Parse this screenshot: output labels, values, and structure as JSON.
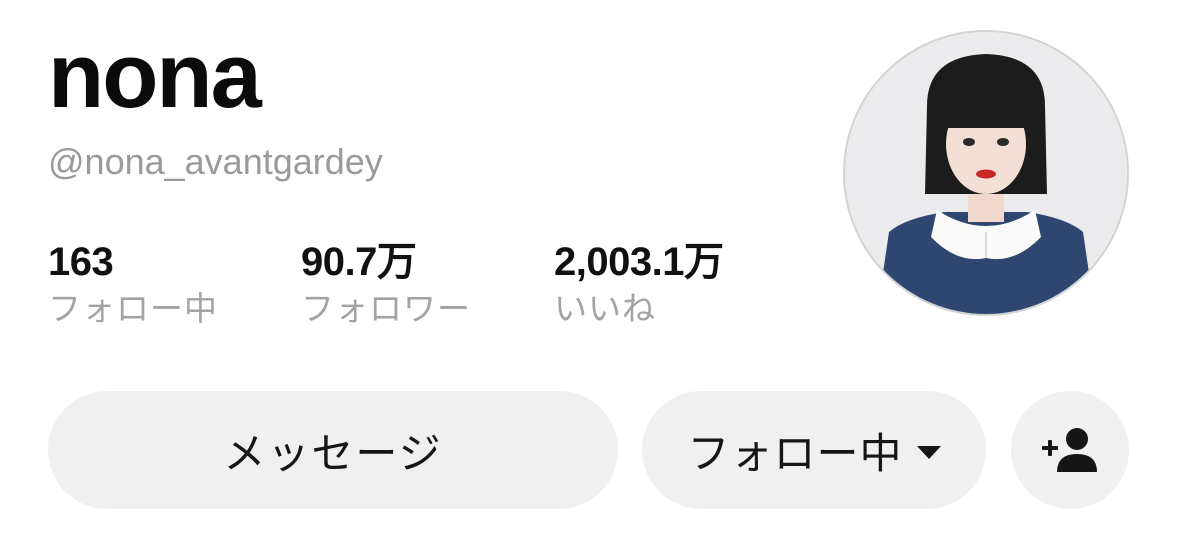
{
  "profile": {
    "name": "nona",
    "handle": "@nona_avantgardey"
  },
  "stats": [
    {
      "value": "163",
      "label": "フォロー中"
    },
    {
      "value": "90.7万",
      "label": "フォロワー"
    },
    {
      "value": "2,003.1万",
      "label": "いいね"
    }
  ],
  "actions": {
    "message_label": "メッセージ",
    "following_label": "フォロー中"
  },
  "icons": {
    "following_caret": "caret-down-icon",
    "add_user": "add-user-icon"
  },
  "colors": {
    "background": "#ffffff",
    "button_bg": "#f0f0f0",
    "secondary_text": "#a3a3a3",
    "handle_text": "#9a9a9a"
  }
}
